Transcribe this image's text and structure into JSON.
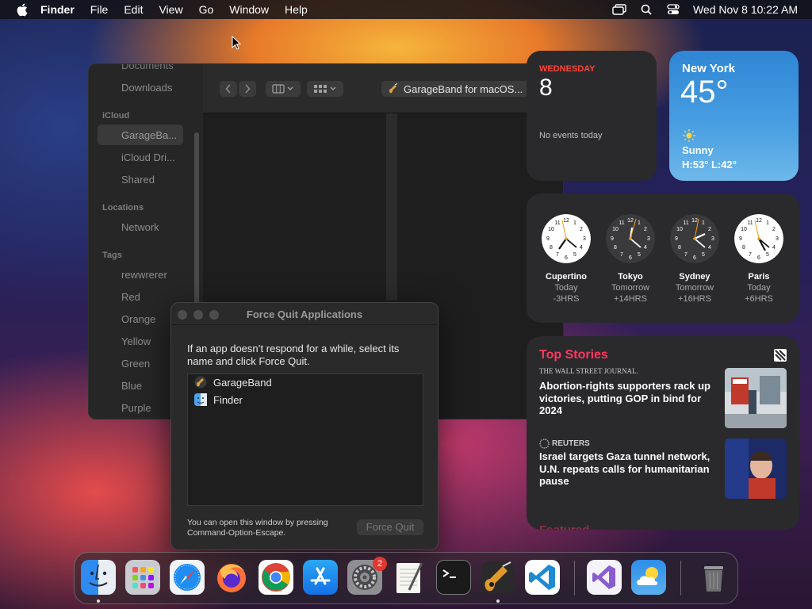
{
  "menubar": {
    "app_name": "Finder",
    "items": [
      "File",
      "Edit",
      "View",
      "Go",
      "Window",
      "Help"
    ],
    "datetime": "Wed Nov 8  10:22 AM",
    "status_icons": [
      "screen-mirroring-icon",
      "search-icon",
      "control-center-icon"
    ]
  },
  "finder": {
    "sidebar": {
      "favorites_cut": [
        "Documents",
        "Downloads"
      ],
      "icloud_title": "iCloud",
      "icloud_items": [
        "GarageBa...",
        "iCloud Dri...",
        "Shared"
      ],
      "locations_title": "Locations",
      "locations_items": [
        "Network"
      ],
      "tags_title": "Tags",
      "tags_items": [
        "rewwrerer",
        "Red",
        "Orange",
        "Yellow",
        "Green",
        "Blue",
        "Purple"
      ]
    },
    "path_label": "GarageBand for macOS..."
  },
  "calendar_widget": {
    "weekday": "WEDNESDAY",
    "date": "8",
    "events": "No events today"
  },
  "weather_widget": {
    "city": "New York",
    "temp": "45°",
    "condition": "Sunny",
    "hilo": "H:53° L:42°"
  },
  "clock_widget": {
    "clocks": [
      {
        "city": "Cupertino",
        "day": "Today",
        "offset": "-3HRS",
        "theme": "light"
      },
      {
        "city": "Tokyo",
        "day": "Tomorrow",
        "offset": "+14HRS",
        "theme": "dark"
      },
      {
        "city": "Sydney",
        "day": "Tomorrow",
        "offset": "+16HRS",
        "theme": "dark"
      },
      {
        "city": "Paris",
        "day": "Today",
        "offset": "+6HRS",
        "theme": "light"
      }
    ]
  },
  "news_widget": {
    "title": "Top Stories",
    "stories": [
      {
        "source": "THE WALL STREET JOURNAL.",
        "headline": "Abortion-rights supporters rack up victories, putting GOP in bind for 2024"
      },
      {
        "source": "REUTERS",
        "headline": "Israel targets Gaza tunnel network, U.N. repeats calls for humanitarian pause"
      }
    ],
    "featured": "Featured"
  },
  "force_quit": {
    "title": "Force Quit Applications",
    "message": "If an app doesn’t respond for a while, select its name and click Force Quit.",
    "apps": [
      "GarageBand",
      "Finder"
    ],
    "hint": "You can open this window by pressing Command-Option-Escape.",
    "button": "Force Quit"
  },
  "dock": {
    "apps": [
      "Finder",
      "Launchpad",
      "Safari",
      "Firefox",
      "Chrome",
      "App Store",
      "System Settings",
      "TextEdit",
      "Terminal",
      "GarageBand",
      "Visual Studio Code",
      "Visual Studio",
      "Weather",
      "Trash"
    ],
    "settings_badge": "2"
  }
}
